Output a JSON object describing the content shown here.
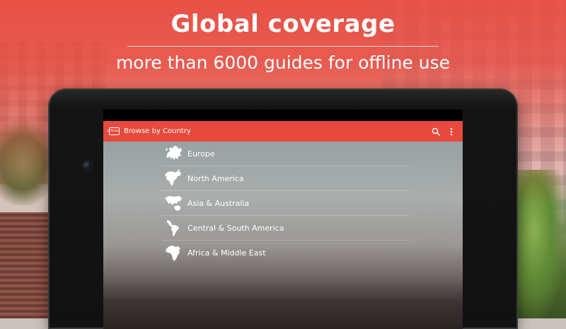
{
  "promo": {
    "headline": "Global coverage",
    "subline": "more than 6000 guides for offline use"
  },
  "app": {
    "logo_text": "Ulmon",
    "title": "Browse by Country",
    "actions": [
      {
        "name": "search",
        "icon": "search-icon"
      },
      {
        "name": "overflow-menu",
        "icon": "more-vert-icon"
      }
    ],
    "accent_color": "#e8493d"
  },
  "regions": [
    {
      "label": "Europe",
      "icon": "europe-map-icon"
    },
    {
      "label": "North America",
      "icon": "north-america-map-icon"
    },
    {
      "label": "Asia & Australia",
      "icon": "asia-australia-map-icon"
    },
    {
      "label": "Central & South America",
      "icon": "south-america-map-icon"
    },
    {
      "label": "Africa & Middle East",
      "icon": "africa-map-icon"
    }
  ]
}
